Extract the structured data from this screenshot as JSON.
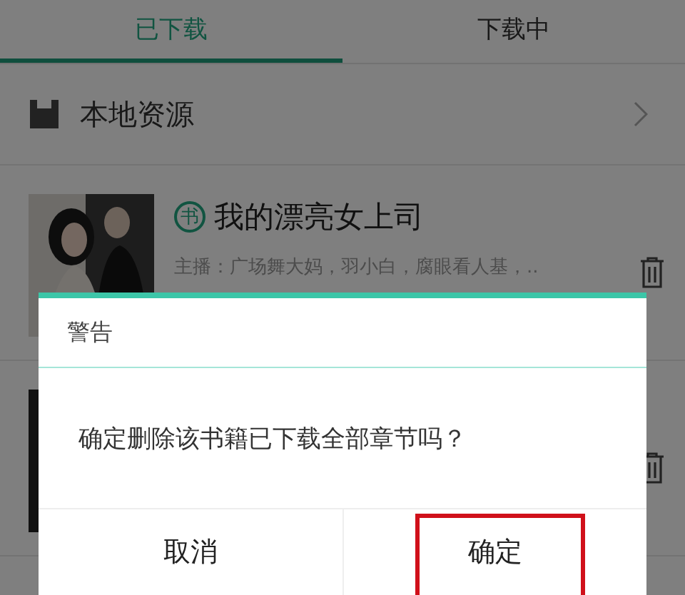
{
  "tabs": [
    {
      "label": "已下载",
      "selected": true
    },
    {
      "label": "下载中",
      "selected": false
    }
  ],
  "local_resources": {
    "label": "本地资源"
  },
  "books": [
    {
      "badge": "书",
      "title": "我的漂亮女上司",
      "hosts": "主播：广场舞大妈，羽小白，腐眼看人基，..",
      "cover": {
        "kind": "picture"
      }
    },
    {
      "cover": {
        "kind": "picture"
      }
    }
  ],
  "dialog": {
    "title": "警告",
    "message": "确定删除该书籍已下载全部章节吗？",
    "buttons": [
      {
        "label": "取消",
        "highlighted": false
      },
      {
        "label": "确定",
        "highlighted": true
      }
    ]
  }
}
